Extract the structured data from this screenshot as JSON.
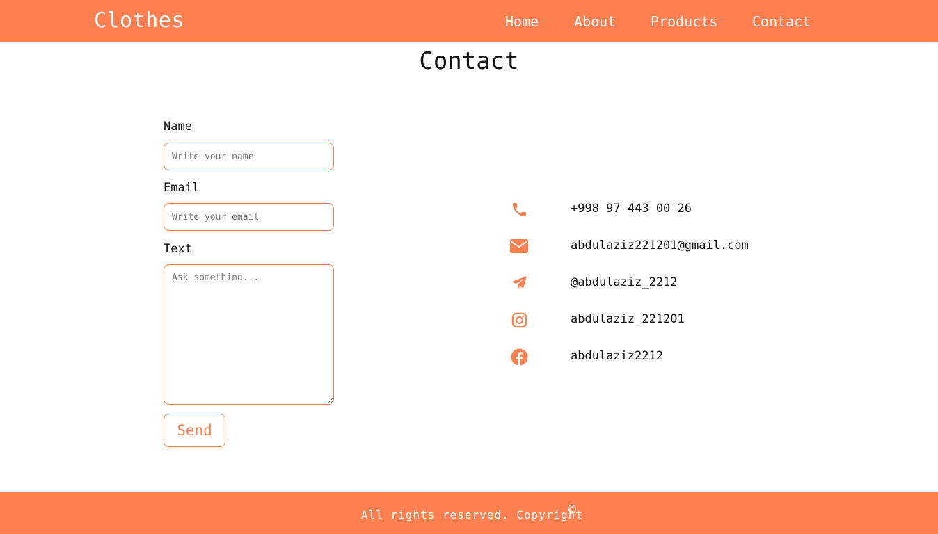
{
  "header": {
    "brand": "Clothes",
    "nav": [
      {
        "label": "Home"
      },
      {
        "label": "About"
      },
      {
        "label": "Products"
      },
      {
        "label": "Contact"
      }
    ]
  },
  "main": {
    "title": "Contact",
    "form": {
      "name_label": "Name",
      "name_placeholder": "Write your name",
      "email_label": "Email",
      "email_placeholder": "Write your email",
      "text_label": "Text",
      "text_placeholder": "Ask something...",
      "send_label": "Send"
    },
    "contacts": [
      {
        "icon": "phone-icon",
        "text": "+998 97 443 00 26"
      },
      {
        "icon": "envelope-icon",
        "text": "abdulaziz221201@gmail.com"
      },
      {
        "icon": "telegram-icon",
        "text": "@abdulaziz_2212"
      },
      {
        "icon": "instagram-icon",
        "text": "abdulaziz_221201"
      },
      {
        "icon": "facebook-icon",
        "text": "abdulaziz2212"
      }
    ]
  },
  "footer": {
    "text": "All rights reserved. Copyright",
    "copyright_symbol": "©"
  },
  "colors": {
    "accent": "#ff7f50",
    "text": "#111111",
    "background": "#ffffff"
  }
}
